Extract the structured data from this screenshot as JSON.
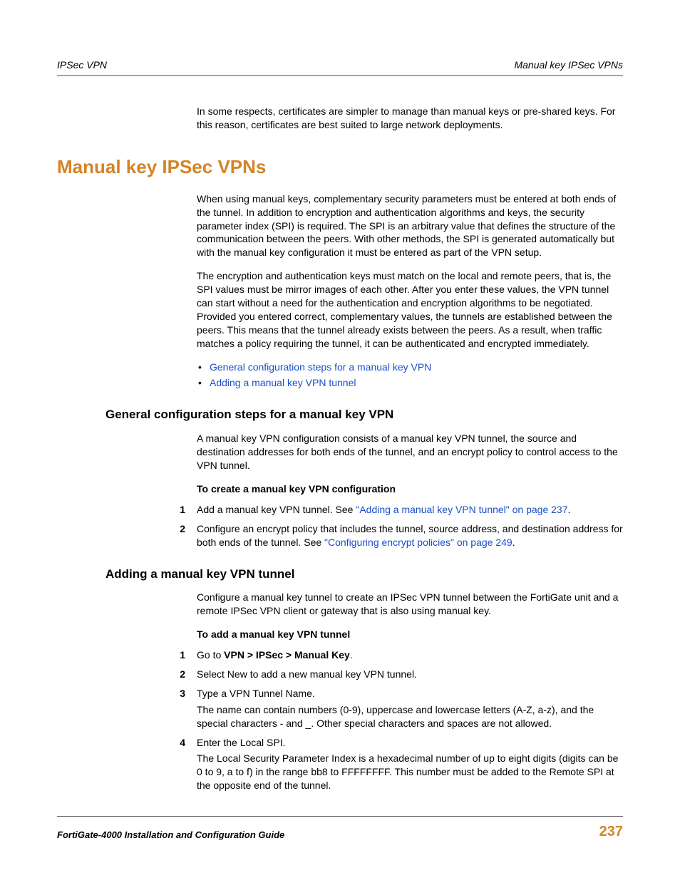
{
  "header": {
    "left": "IPSec VPN",
    "right": "Manual key IPSec VPNs"
  },
  "intro_para": "In some respects, certificates are simpler to manage than manual keys or pre-shared keys. For this reason, certificates are best suited to large network deployments.",
  "h1": "Manual key IPSec VPNs",
  "p1": "When using manual keys, complementary security parameters must be entered at both ends of the tunnel. In addition to encryption and authentication algorithms and keys, the security parameter index (SPI) is required. The SPI is an arbitrary value that defines the structure of the communication between the peers. With other methods, the SPI is generated automatically but with the manual key configuration it must be entered as part of the VPN setup.",
  "p2": "The encryption and authentication keys must match on the local and remote peers, that is, the SPI values must be mirror images of each other. After you enter these values, the VPN tunnel can start without a need for the authentication and encryption algorithms to be negotiated. Provided you entered correct, complementary values, the tunnels are established between the peers. This means that the tunnel already exists between the peers. As a result, when traffic matches a policy requiring the tunnel, it can be authenticated and encrypted immediately.",
  "links": [
    "General configuration steps for a manual key VPN",
    "Adding a manual key VPN tunnel"
  ],
  "sec1": {
    "title": "General configuration steps for a manual key VPN",
    "intro": "A manual key VPN configuration consists of a manual key VPN tunnel, the source and destination addresses for both ends of the tunnel, and an encrypt policy to control access to the VPN tunnel.",
    "proc_title": "To create a manual key VPN configuration",
    "steps": {
      "s1a": "Add a manual key VPN tunnel. See ",
      "s1b": "\"Adding a manual key VPN tunnel\" on page 237",
      "s1c": ".",
      "s2a": "Configure an encrypt policy that includes the tunnel, source address, and destination address for both ends of the tunnel. See ",
      "s2b": "\"Configuring encrypt policies\" on page 249",
      "s2c": "."
    }
  },
  "sec2": {
    "title": "Adding a manual key VPN tunnel",
    "intro": "Configure a manual key tunnel to create an IPSec VPN tunnel between the FortiGate unit and a remote IPSec VPN client or gateway that is also using manual key.",
    "proc_title": "To add a manual key VPN tunnel",
    "steps": {
      "s1_pre": "Go to ",
      "s1_bold": "VPN > IPSec > Manual Key",
      "s1_post": ".",
      "s2": "Select New to add a new manual key VPN tunnel.",
      "s3": "Type a VPN Tunnel Name.",
      "s3_note": "The name can contain numbers (0-9), uppercase and lowercase letters (A-Z, a-z), and the special characters - and _. Other special characters and spaces are not allowed.",
      "s4": "Enter the Local SPI.",
      "s4_note": "The Local Security Parameter Index is a hexadecimal number of up to eight digits (digits can be 0 to 9, a to f) in the range bb8 to FFFFFFFF. This number must be added to the Remote SPI at the opposite end of the tunnel."
    }
  },
  "footer": {
    "left": "FortiGate-4000 Installation and Configuration Guide",
    "page": "237"
  }
}
